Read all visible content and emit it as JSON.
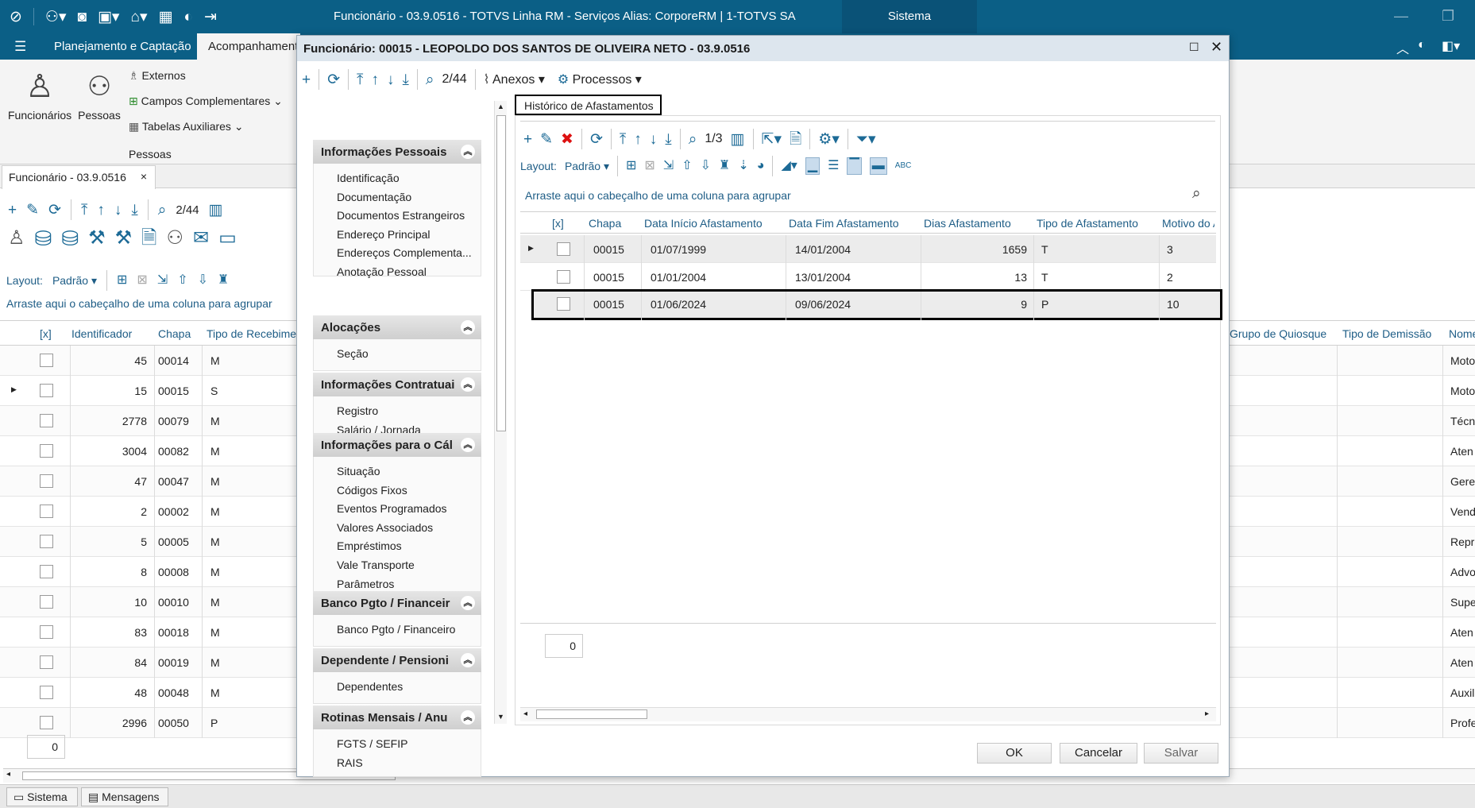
{
  "window": {
    "title": "Funcionário - 03.9.0516 - TOTVS Linha RM - Serviços  Alias: CorporeRM | 1-TOTVS SA",
    "sistema": "Sistema"
  },
  "ribbon": {
    "tabs": [
      "Planejamento e Captação",
      "Acompanhamento"
    ],
    "funcionarios": "Funcionários",
    "pessoas": "Pessoas",
    "externos": "Externos",
    "campos_complementares": "Campos Complementares",
    "tabelas_auxiliares": "Tabelas Auxiliares",
    "group_label": "Pessoas"
  },
  "doc_tab": {
    "label": "Funcionário - 03.9.0516",
    "close": "×"
  },
  "bg": {
    "counter": "2/44",
    "layout_label": "Layout:",
    "layout_value": "Padrão",
    "group_hint": "Arraste aqui o cabeçalho de uma coluna para agrupar",
    "columns": [
      "[x]",
      "Identificador",
      "Chapa",
      "Tipo de Recebime"
    ],
    "right_columns": [
      "Grupo de Quiosque",
      "Tipo de Demissão",
      "Nome"
    ],
    "rows": [
      {
        "id": "45",
        "chapa": "00014",
        "tipo": "M",
        "nome": "Moto"
      },
      {
        "id": "15",
        "chapa": "00015",
        "tipo": "S",
        "nome": "Moto"
      },
      {
        "id": "2778",
        "chapa": "00079",
        "tipo": "M",
        "nome": "Técn"
      },
      {
        "id": "3004",
        "chapa": "00082",
        "tipo": "M",
        "nome": "Aten"
      },
      {
        "id": "47",
        "chapa": "00047",
        "tipo": "M",
        "nome": "Gere"
      },
      {
        "id": "2",
        "chapa": "00002",
        "tipo": "M",
        "nome": "Vend"
      },
      {
        "id": "5",
        "chapa": "00005",
        "tipo": "M",
        "nome": "Repr"
      },
      {
        "id": "8",
        "chapa": "00008",
        "tipo": "M",
        "nome": "Advo"
      },
      {
        "id": "10",
        "chapa": "00010",
        "tipo": "M",
        "nome": "Supe"
      },
      {
        "id": "83",
        "chapa": "00018",
        "tipo": "M",
        "nome": "Aten"
      },
      {
        "id": "84",
        "chapa": "00019",
        "tipo": "M",
        "nome": "Aten"
      },
      {
        "id": "48",
        "chapa": "00048",
        "tipo": "M",
        "nome": "Auxil"
      },
      {
        "id": "2996",
        "chapa": "00050",
        "tipo": "P",
        "nome": "Profe"
      }
    ],
    "footer_count": "0"
  },
  "statusbar": {
    "sistema": "Sistema",
    "mensagens": "Mensagens"
  },
  "dialog": {
    "title": "Funcionário: 00015 - LEOPOLDO DOS SANTOS DE OLIVEIRA NETO - 03.9.0516",
    "counter": "2/44",
    "anexos": "Anexos",
    "processos": "Processos",
    "nav": [
      {
        "header": "Informações Pessoais",
        "items": [
          "Identificação",
          "Documentação",
          "Documentos Estrangeiros",
          "Endereço Principal",
          "Endereços Complementa...",
          "Anotação Pessoal"
        ]
      },
      {
        "header": "Alocações",
        "items": [
          "Seção"
        ]
      },
      {
        "header": "Informações Contratuai",
        "items": [
          "Registro",
          "Salário / Jornada"
        ]
      },
      {
        "header": "Informações para o Cál",
        "items": [
          "Situação",
          "Códigos Fixos",
          "Eventos Programados",
          "Valores Associados",
          "Empréstimos",
          "Vale Transporte",
          "Parâmetros"
        ]
      },
      {
        "header": "Banco Pgto / Financeir",
        "items": [
          "Banco Pgto / Financeiro"
        ]
      },
      {
        "header": "Dependente / Pensioni",
        "items": [
          "Dependentes"
        ]
      },
      {
        "header": "Rotinas Mensais / Anu",
        "items": [
          "FGTS / SEFIP",
          "RAIS"
        ]
      }
    ],
    "tab_label": "Histórico de Afastamentos",
    "inner": {
      "counter": "1/3",
      "layout_label": "Layout:",
      "layout_value": "Padrão",
      "group_hint": "Arraste aqui o cabeçalho de uma coluna para agrupar",
      "columns": [
        "[x]",
        "Chapa",
        "Data Início Afastamento",
        "Data Fim Afastamento",
        "Dias Afastamento",
        "Tipo de Afastamento",
        "Motivo do Af"
      ],
      "rows": [
        {
          "chapa": "00015",
          "inicio": "01/07/1999",
          "fim": "14/01/2004",
          "dias": "1659",
          "tipo": "T",
          "motivo": "3"
        },
        {
          "chapa": "00015",
          "inicio": "01/01/2004",
          "fim": "13/01/2004",
          "dias": "13",
          "tipo": "T",
          "motivo": "2"
        },
        {
          "chapa": "00015",
          "inicio": "01/06/2024",
          "fim": "09/06/2024",
          "dias": "9",
          "tipo": "P",
          "motivo": "10"
        }
      ],
      "footer_count": "0"
    },
    "buttons": {
      "ok": "OK",
      "cancel": "Cancelar",
      "save": "Salvar"
    }
  }
}
